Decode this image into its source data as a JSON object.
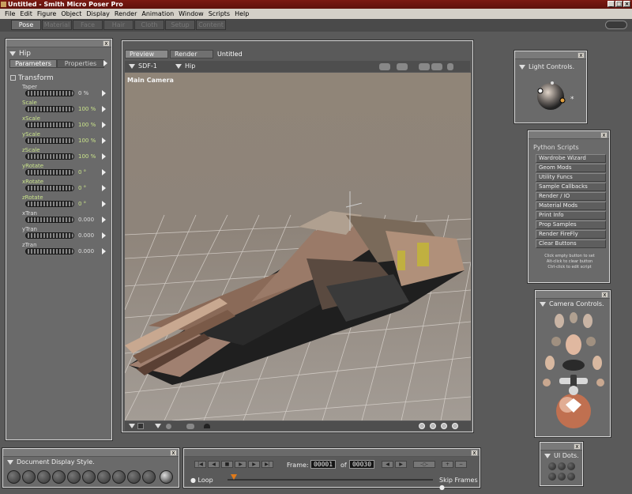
{
  "window": {
    "title": "Untitled - Smith Micro Poser Pro",
    "btn_min": "_",
    "btn_max": "□",
    "btn_close": "×"
  },
  "menu": [
    "File",
    "Edit",
    "Figure",
    "Object",
    "Display",
    "Render",
    "Animation",
    "Window",
    "Scripts",
    "Help"
  ],
  "rooms": [
    {
      "label": "Pose",
      "active": true
    },
    {
      "label": "Material",
      "active": false
    },
    {
      "label": "Face",
      "active": false
    },
    {
      "label": "Hair",
      "active": false
    },
    {
      "label": "Cloth",
      "active": false
    },
    {
      "label": "Setup",
      "active": false
    },
    {
      "label": "Content",
      "active": false
    }
  ],
  "params_panel": {
    "actor": "Hip",
    "tabs": [
      "Parameters",
      "Properties"
    ],
    "group": "Transform",
    "close": "x",
    "dials": [
      {
        "label": "Taper",
        "value": "0 %",
        "highlight": false
      },
      {
        "label": "Scale",
        "value": "100 %",
        "highlight": true
      },
      {
        "label": "xScale",
        "value": "100 %",
        "highlight": true
      },
      {
        "label": "yScale",
        "value": "100 %",
        "highlight": true
      },
      {
        "label": "zScale",
        "value": "100 %",
        "highlight": true
      },
      {
        "label": "yRotate",
        "value": "0 °",
        "highlight": true
      },
      {
        "label": "xRotate",
        "value": "0 °",
        "highlight": true
      },
      {
        "label": "zRotate",
        "value": "0 °",
        "highlight": true
      },
      {
        "label": "xTran",
        "value": "0.000",
        "highlight": false
      },
      {
        "label": "yTran",
        "value": "0.000",
        "highlight": false
      },
      {
        "label": "zTran",
        "value": "0.000",
        "highlight": false
      }
    ]
  },
  "document": {
    "tabs": [
      "Preview",
      "Render"
    ],
    "title": "Untitled",
    "figure_select": "SDF-1",
    "actor_select": "Hip",
    "camera_label": "Main Camera"
  },
  "light_controls": {
    "title": "Light Controls."
  },
  "python_scripts": {
    "title": "Python Scripts",
    "buttons": [
      "Wardrobe Wizard",
      "Geom Mods",
      "Utility Funcs",
      "Sample Callbacks",
      "Render / IO",
      "Material Mods",
      "Print Info",
      "Prop Samples",
      "Render FireFly",
      "Clear Buttons"
    ],
    "notes": [
      "Click empty button to set",
      "Alt-click to clear button",
      "Ctrl-click to edit script"
    ]
  },
  "camera_controls": {
    "title": "Camera Controls."
  },
  "document_display_style": {
    "title": "Document Display Style."
  },
  "animation": {
    "frame_label": "Frame:",
    "current_frame": "00001",
    "of_label": "of",
    "total_frames": "00030",
    "loop_label": "Loop",
    "skip_label": "Skip Frames",
    "playhead_position": 0.03
  },
  "ui_dots": {
    "title": "UI Dots."
  },
  "colors": {
    "titlebar": "#7b1a12",
    "highlight_dial": "#c9e38a",
    "timeline_thumb": "#e07a1a"
  }
}
